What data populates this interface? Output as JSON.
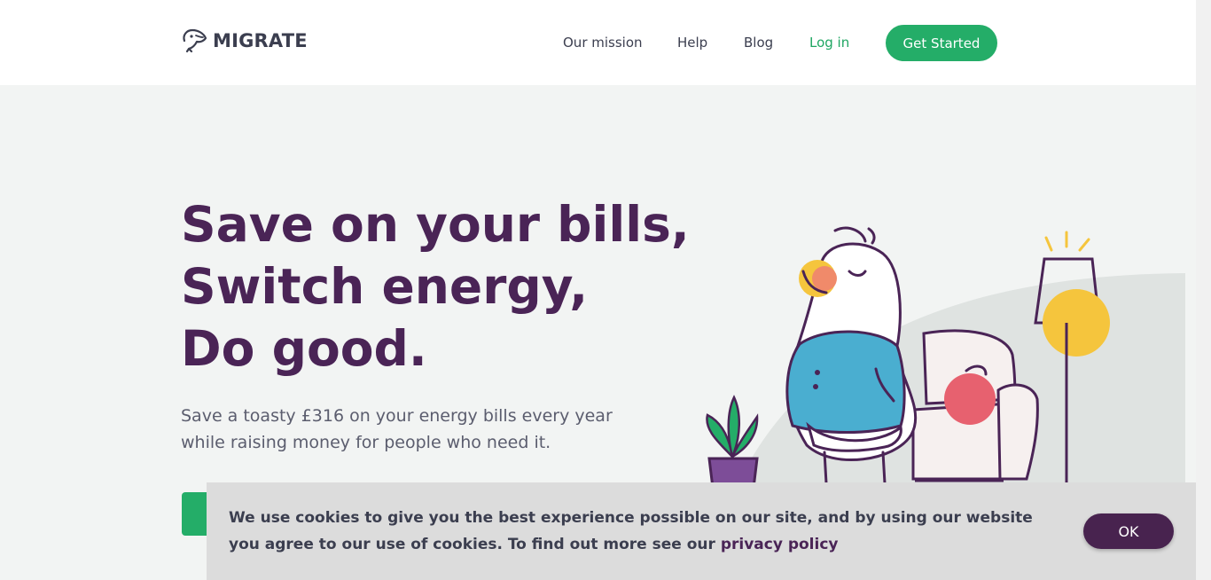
{
  "nav": {
    "logo_text": "MIGRATE",
    "links": [
      {
        "label": "Our mission"
      },
      {
        "label": "Help"
      },
      {
        "label": "Blog"
      },
      {
        "label": "Log in"
      }
    ],
    "cta_label": "Get Started"
  },
  "hero": {
    "title_lines": [
      "Save on your bills,",
      "Switch energy,",
      "Do good."
    ],
    "subtitle_line1": "Save a toasty £316 on your energy bills every year",
    "subtitle_line2": "while raising money for people who need it."
  },
  "cookie": {
    "text": "We use cookies to give you the best experience possible on our site, and by using our website you agree to our use of cookies. To find out more see our ",
    "link_label": "privacy policy",
    "ok_label": "OK"
  },
  "colors": {
    "brand_green": "#24ad68",
    "brand_purple": "#4a2456",
    "ok_button": "#48234f",
    "cookie_bg": "#dcdcdc",
    "hero_bg": "#f2f4f3"
  },
  "icons": {
    "logo": "bird-logo-icon"
  }
}
